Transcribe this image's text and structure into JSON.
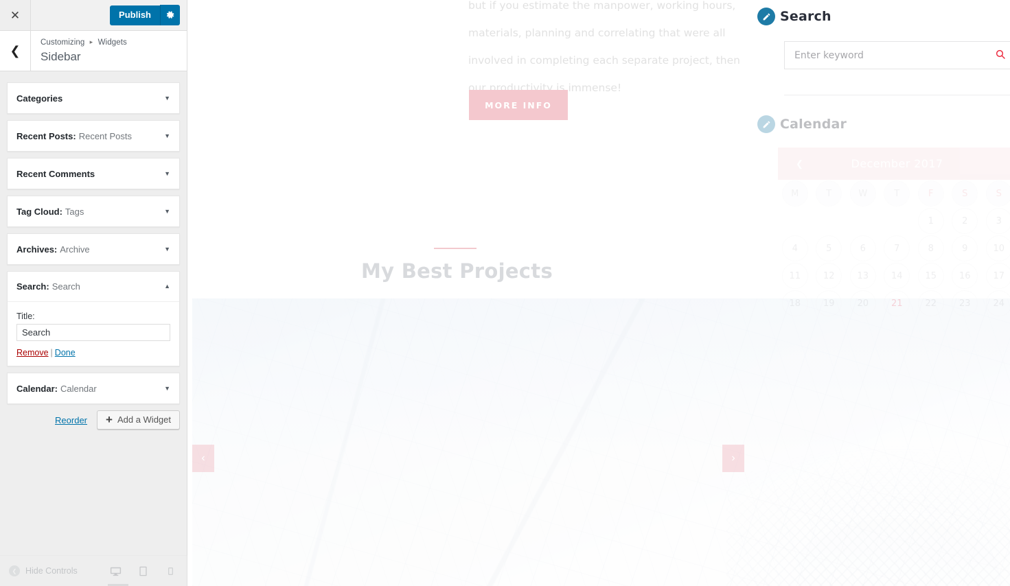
{
  "customizer": {
    "top_bar": {
      "close_icon": "close-icon",
      "publish_label": "Publish",
      "gear_icon": "gear-icon"
    },
    "header": {
      "back_icon": "chevron-left-icon",
      "breadcrumb_root": "Customizing",
      "breadcrumb_separator": "▸",
      "breadcrumb_section": "Widgets",
      "panel_title": "Sidebar"
    },
    "widgets": [
      {
        "name": "Categories",
        "instance": "",
        "expanded": false,
        "arrow": "▼"
      },
      {
        "name": "Recent Posts:",
        "instance": "Recent Posts",
        "expanded": false,
        "arrow": "▼"
      },
      {
        "name": "Recent Comments",
        "instance": "",
        "expanded": false,
        "arrow": "▼"
      },
      {
        "name": "Tag Cloud:",
        "instance": "Tags",
        "expanded": false,
        "arrow": "▼"
      },
      {
        "name": "Archives:",
        "instance": "Archive",
        "expanded": false,
        "arrow": "▼"
      },
      {
        "name": "Search:",
        "instance": "Search",
        "expanded": true,
        "arrow": "▲"
      },
      {
        "name": "Calendar:",
        "instance": "Calendar",
        "expanded": false,
        "arrow": "▼"
      }
    ],
    "search_widget_form": {
      "title_label": "Title:",
      "title_value": "Search",
      "remove_label": "Remove",
      "separator": "|",
      "done_label": "Done"
    },
    "footer_actions": {
      "reorder_label": "Reorder",
      "add_widget_label": "Add a Widget",
      "add_widget_icon": "plus-icon"
    },
    "bottom_bar": {
      "hide_controls_label": "Hide Controls",
      "collapse_icon": "chevron-left-circle-icon",
      "devices": [
        {
          "icon": "desktop-icon",
          "active": true
        },
        {
          "icon": "tablet-icon",
          "active": false
        },
        {
          "icon": "mobile-icon",
          "active": false
        }
      ]
    },
    "colors": {
      "publish_blue": "#0073aa",
      "panel_bg": "#eeeeee",
      "link_blue": "#0073aa",
      "remove_red": "#a00"
    }
  },
  "preview": {
    "hero": {
      "paragraph": "but if you estimate the manpower, working hours, materials, planning and correlating that were all involved in completing each separate project, then our productivity is immense!",
      "cta_label": "MORE INFO"
    },
    "projects_section": {
      "title": "My Best Projects",
      "prev_arrow": "‹",
      "next_arrow": "›"
    },
    "sidebar": {
      "search_widget": {
        "edit_icon": "edit-pencil-icon",
        "title": "Search",
        "input_placeholder": "Enter keyword",
        "input_value": "",
        "search_icon": "search-icon"
      },
      "calendar_widget": {
        "edit_icon": "edit-pencil-icon",
        "title": "Calendar",
        "month_label": "December 2017",
        "prev_icon": "❮",
        "day_headers": [
          "M",
          "T",
          "W",
          "T",
          "F",
          "S",
          "S"
        ],
        "leading_blanks": 4,
        "days": [
          1,
          2,
          3,
          4,
          5,
          6,
          7,
          8,
          9,
          10,
          11,
          12,
          13,
          14,
          15,
          16,
          17,
          18,
          19,
          20,
          21,
          22,
          23,
          24
        ],
        "today": 21,
        "weekend_columns": [
          5,
          6
        ]
      }
    },
    "colors": {
      "accent_pink": "#f4c8ce",
      "search_red": "#ec2b3f",
      "edit_badge_blue": "#1e7ba6"
    }
  }
}
